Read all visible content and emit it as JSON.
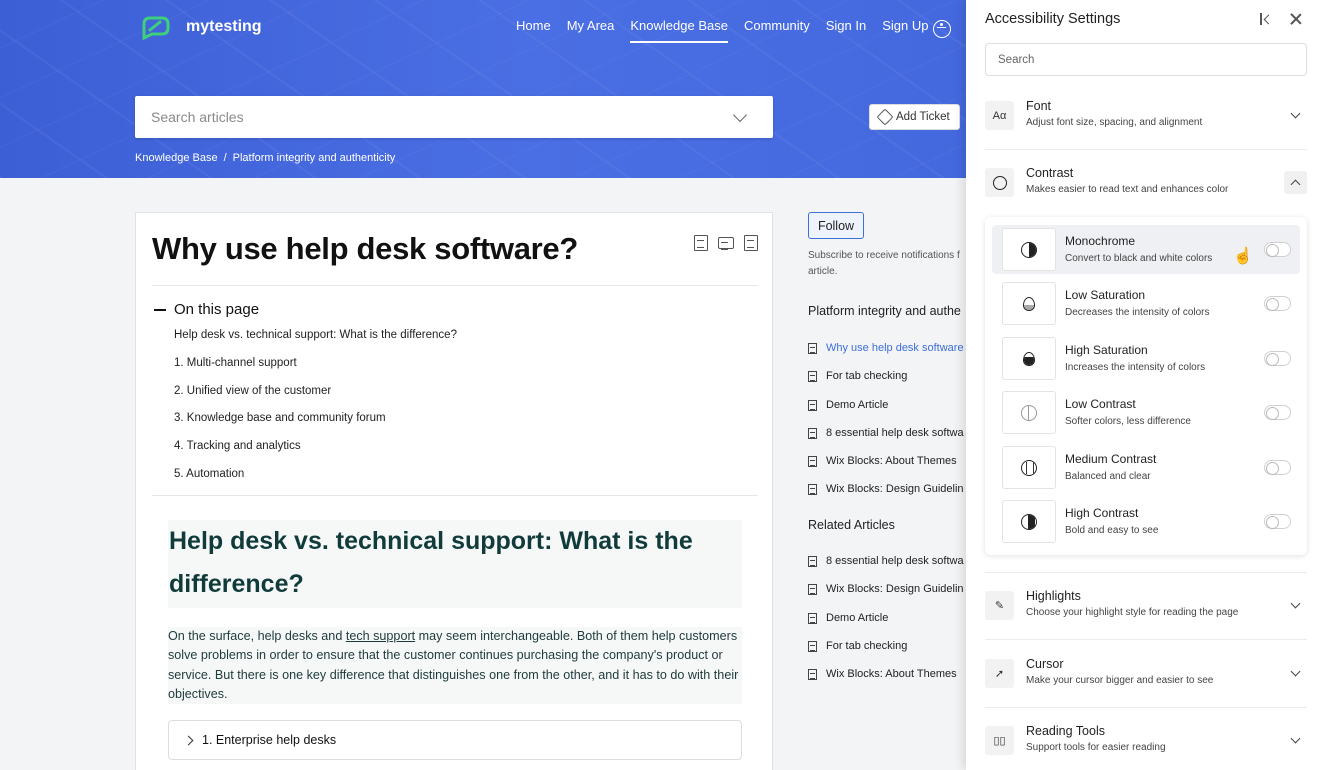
{
  "header": {
    "logo_text": "mytesting",
    "nav": [
      "Home",
      "My Area",
      "Knowledge Base",
      "Community",
      "Sign In",
      "Sign Up"
    ],
    "active_nav": "Knowledge Base",
    "search_placeholder": "Search articles",
    "add_ticket_label": "Add Ticket",
    "breadcrumb": [
      "Knowledge Base",
      "/",
      "Platform integrity and authenticity"
    ]
  },
  "article": {
    "title": "Why use help desk software?",
    "toc_heading": "On this page",
    "toc": [
      "Help desk vs. technical support: What is the difference?",
      "1. Multi-channel support",
      "2. Unified view of the customer",
      "3. Knowledge base and community forum",
      "4. Tracking and analytics",
      "5. Automation"
    ],
    "h2": "Help desk vs. technical support: What is the difference?",
    "para_before": "On the surface, help desks and ",
    "para_link": "tech support",
    "para_after": " may seem interchangeable. Both of them help customers solve problems in order to ensure that the customer continues purchasing the company's product or service. But there is one key difference that distinguishes one from the other, and it has to do with their objectives.",
    "accordion_label": "1. Enterprise help desks"
  },
  "sidebar": {
    "follow_label": "Follow",
    "subscribe_text": "Subscribe to receive notifications f",
    "subscribe_text2": "article.",
    "category_heading": "Platform integrity and authe",
    "category_items": [
      "Why use help desk software",
      "For tab checking",
      "Demo Article",
      "8 essential help desk softwa",
      "Wix Blocks: About Themes",
      "Wix Blocks: Design Guidelin"
    ],
    "related_heading": "Related Articles",
    "related_items": [
      "8 essential help desk softwa",
      "Wix Blocks: Design Guidelin",
      "Demo Article",
      "For tab checking",
      "Wix Blocks: About Themes"
    ]
  },
  "panel": {
    "title": "Accessibility Settings",
    "search_placeholder": "Search",
    "sections": {
      "font": {
        "title": "Font",
        "desc": "Adjust font size, spacing, and alignment",
        "icon": "Aα"
      },
      "contrast": {
        "title": "Contrast",
        "desc": "Makes easier to read text and enhances color"
      },
      "highlights": {
        "title": "Highlights",
        "desc": "Choose your highlight style for reading the page"
      },
      "cursor": {
        "title": "Cursor",
        "desc": "Make your cursor bigger and easier to see"
      },
      "reading": {
        "title": "Reading Tools",
        "desc": "Support tools for easier reading"
      }
    },
    "contrast_options": [
      {
        "title": "Monochrome",
        "desc": "Convert to black and white colors",
        "on": false
      },
      {
        "title": "Low Saturation",
        "desc": "Decreases the intensity of colors",
        "on": false
      },
      {
        "title": "High Saturation",
        "desc": "Increases the intensity of colors",
        "on": false
      },
      {
        "title": "Low Contrast",
        "desc": "Softer colors, less difference",
        "on": false
      },
      {
        "title": "Medium Contrast",
        "desc": "Balanced and clear",
        "on": false
      },
      {
        "title": "High Contrast",
        "desc": "Bold and easy to see",
        "on": false
      }
    ]
  },
  "colors": {
    "hero": "#3f63da",
    "link": "#3d6fd9",
    "heading": "#113b3b"
  }
}
